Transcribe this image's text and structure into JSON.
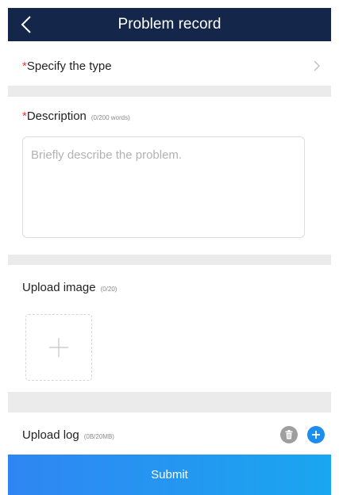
{
  "header": {
    "title": "Problem record",
    "back_icon": "chevron-left-icon"
  },
  "type_row": {
    "required_mark": "*",
    "label": "Specify the type",
    "chevron_icon": "chevron-right-icon"
  },
  "description": {
    "required_mark": "*",
    "label": "Description",
    "counter": "(0/200 words)",
    "value": "",
    "placeholder": "Briefly describe the problem."
  },
  "upload_image": {
    "label": "Upload image",
    "counter": "(0/20)",
    "add_icon": "plus-icon"
  },
  "upload_log": {
    "label": "Upload log",
    "counter": "(0B/20MB)",
    "delete_icon": "trash-icon",
    "add_icon": "plus-circle-icon"
  },
  "submit": {
    "label": "Submit"
  },
  "colors": {
    "header_bg": "#14274a",
    "required": "#e53935",
    "accent": "#1e8df0",
    "separator": "#ebebeb"
  }
}
